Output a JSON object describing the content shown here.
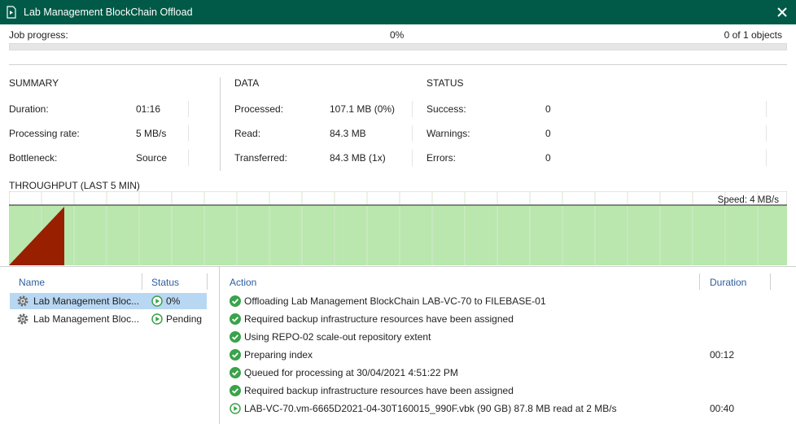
{
  "window": {
    "title": "Lab Management BlockChain Offload",
    "accent_color": "#005a47"
  },
  "progress": {
    "label": "Job progress:",
    "percent_text": "0%",
    "objects_text": "0 of 1 objects",
    "fraction": 0.0
  },
  "summary": {
    "heading": "SUMMARY",
    "rows": [
      {
        "label": "Duration:",
        "value": "01:16"
      },
      {
        "label": "Processing rate:",
        "value": "5 MB/s"
      },
      {
        "label": "Bottleneck:",
        "value": "Source"
      }
    ]
  },
  "data_section": {
    "heading": "DATA",
    "rows": [
      {
        "label": "Processed:",
        "value": "107.1 MB (0%)"
      },
      {
        "label": "Read:",
        "value": "84.3 MB"
      },
      {
        "label": "Transferred:",
        "value": "84.3 MB (1x)"
      }
    ]
  },
  "status_section": {
    "heading": "STATUS",
    "rows": [
      {
        "label": "Success:",
        "value": "0"
      },
      {
        "label": "Warnings:",
        "value": "0"
      },
      {
        "label": "Errors:",
        "value": "0"
      }
    ]
  },
  "throughput": {
    "title": "THROUGHPUT (LAST 5 MIN)",
    "speed_text": "Speed: 4 MB/s",
    "fill_color": "#b9e7ad",
    "spike_color": "#981f00"
  },
  "jobs": {
    "headers": {
      "name": "Name",
      "status": "Status"
    },
    "items": [
      {
        "name": "Lab Management Bloc...",
        "status": "0%",
        "selected": true
      },
      {
        "name": "Lab Management Bloc...",
        "status": "Pending",
        "selected": false
      }
    ]
  },
  "actions": {
    "headers": {
      "action": "Action",
      "duration": "Duration"
    },
    "items": [
      {
        "icon": "success-check-icon",
        "text": "Offloading Lab Management BlockChain LAB-VC-70 to FILEBASE-01",
        "duration": ""
      },
      {
        "icon": "success-check-icon",
        "text": "Required backup infrastructure resources have been assigned",
        "duration": ""
      },
      {
        "icon": "success-check-icon",
        "text": "Using REPO-02 scale-out repository extent",
        "duration": ""
      },
      {
        "icon": "success-check-icon",
        "text": "Preparing index",
        "duration": "00:12"
      },
      {
        "icon": "success-check-icon",
        "text": "Queued for processing at 30/04/2021 4:51:22 PM",
        "duration": ""
      },
      {
        "icon": "success-check-icon",
        "text": "Required backup infrastructure resources have been assigned",
        "duration": ""
      },
      {
        "icon": "running-play-icon",
        "text": "LAB-VC-70.vm-6665D2021-04-30T160015_990F.vbk (90 GB) 87.8 MB read at 2 MB/s",
        "duration": "00:40"
      }
    ]
  }
}
